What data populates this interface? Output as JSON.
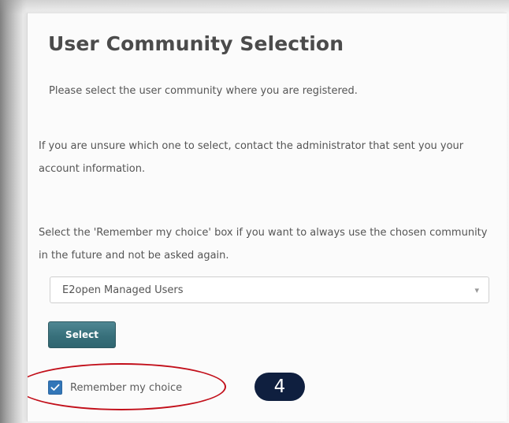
{
  "page": {
    "title": "User Community Selection",
    "intro": "Please select the user community where you are registered.",
    "unsure_note": "If you are unsure which one to select, contact the administrator that sent you your account information.",
    "remember_note": "Select the 'Remember my choice' box if you want to always use the chosen community in the future and not be asked again."
  },
  "community_select": {
    "selected_value": "E2open Managed Users"
  },
  "buttons": {
    "select_label": "Select"
  },
  "remember_choice": {
    "label": "Remember my choice",
    "checked": true
  },
  "annotation": {
    "step_number": "4",
    "highlight_color": "#c20f1a",
    "badge_color": "#0f1f3f"
  },
  "colors": {
    "button_accent": "#38707b",
    "checkbox_accent": "#3276b8",
    "title_text": "#4b4b4b"
  },
  "icons": {
    "checkbox_check": "check-icon",
    "dropdown_chevron": "chevron-down-icon"
  }
}
